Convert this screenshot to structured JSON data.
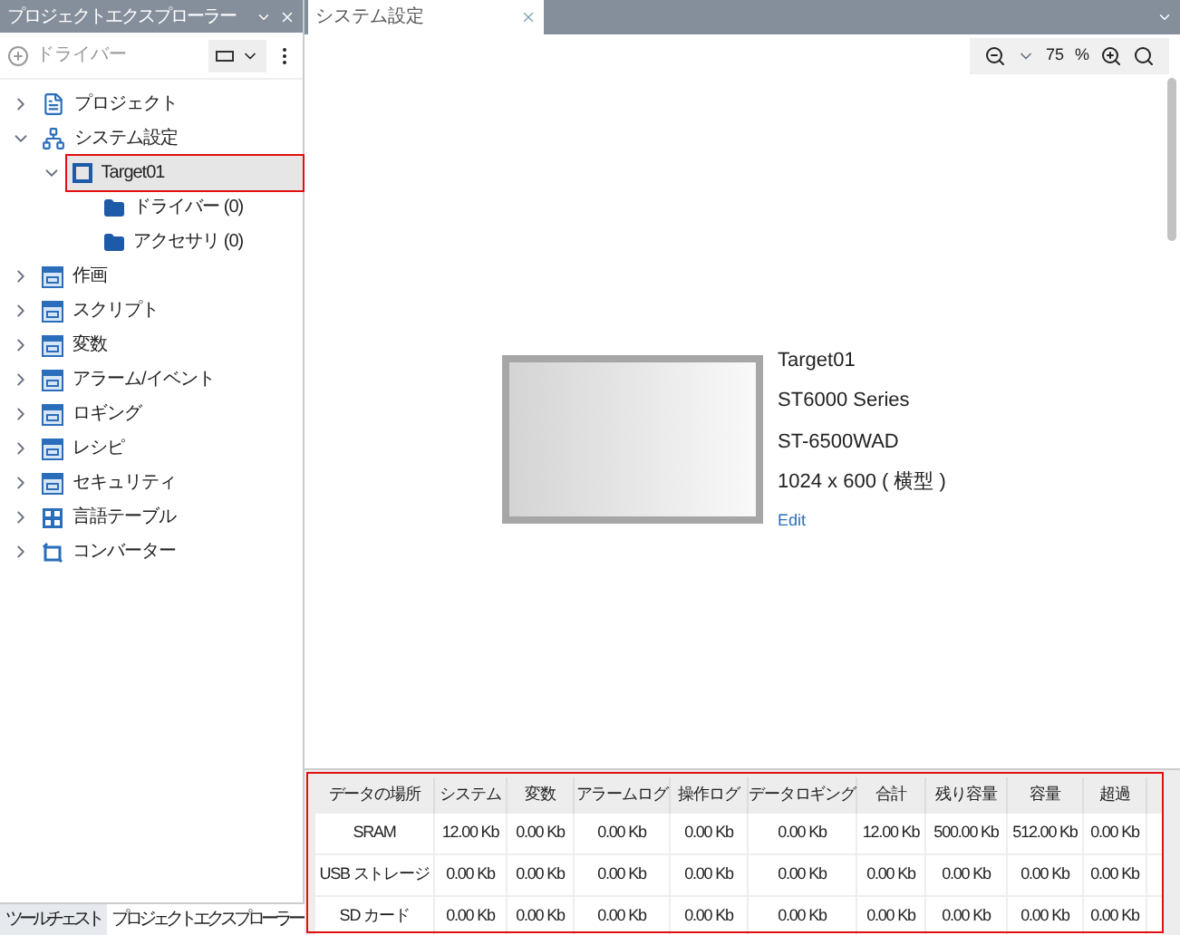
{
  "explorer": {
    "title": "プロジェクトエクスプローラー",
    "add_button": "ドライバー",
    "tree": [
      {
        "label": "プロジェクト",
        "kind": "page",
        "expanded": false,
        "selected": false
      },
      {
        "label": "システム設定",
        "kind": "network",
        "expanded": true,
        "selected": false,
        "children": [
          {
            "label": "Target01",
            "kind": "target",
            "expanded": true,
            "selected": true,
            "highlighted": true,
            "children": [
              {
                "label": "ドライバー (0)",
                "kind": "folder",
                "selected": false
              },
              {
                "label": "アクセサリ (0)",
                "kind": "folder",
                "selected": false
              }
            ]
          }
        ]
      },
      {
        "label": "作画",
        "kind": "screen",
        "expanded": false,
        "selected": false
      },
      {
        "label": "スクリプト",
        "kind": "screen",
        "expanded": false,
        "selected": false
      },
      {
        "label": "変数",
        "kind": "screen",
        "expanded": false,
        "selected": false
      },
      {
        "label": "アラーム/イベント",
        "kind": "screen",
        "expanded": false,
        "selected": false
      },
      {
        "label": "ロギング",
        "kind": "screen",
        "expanded": false,
        "selected": false
      },
      {
        "label": "レシピ",
        "kind": "screen",
        "expanded": false,
        "selected": false
      },
      {
        "label": "セキュリティ",
        "kind": "screen",
        "expanded": false,
        "selected": false
      },
      {
        "label": "言語テーブル",
        "kind": "grid",
        "expanded": false,
        "selected": false
      },
      {
        "label": "コンバーター",
        "kind": "convert",
        "expanded": false,
        "selected": false
      }
    ],
    "bottom_tabs": [
      {
        "label": "ツールチェスト",
        "selected": false
      },
      {
        "label": "プロジェクトエクスプローラー",
        "selected": true
      }
    ]
  },
  "document": {
    "tab": "システム設定",
    "zoom": "75",
    "zoom_unit": "%",
    "device": {
      "name": "Target01",
      "series": "ST6000 Series",
      "model": "ST-6500WAD",
      "resolution": "1024 x 600 ( 横型 )",
      "edit_link": "Edit"
    },
    "table": {
      "highlighted": true,
      "columns": [
        "データの場所",
        "システム",
        "変数",
        "アラームログ",
        "操作ログ",
        "データロギング",
        "合計",
        "残り容量",
        "容量",
        "超過"
      ],
      "rows": [
        [
          "SRAM",
          "12.00 Kb",
          "0.00 Kb",
          "0.00 Kb",
          "0.00 Kb",
          "0.00 Kb",
          "12.00 Kb",
          "500.00 Kb",
          "512.00 Kb",
          "0.00 Kb"
        ],
        [
          "USB ストレージ",
          "0.00 Kb",
          "0.00 Kb",
          "0.00 Kb",
          "0.00 Kb",
          "0.00 Kb",
          "0.00 Kb",
          "0.00 Kb",
          "0.00 Kb",
          "0.00 Kb"
        ],
        [
          "SD カード",
          "0.00 Kb",
          "0.00 Kb",
          "0.00 Kb",
          "0.00 Kb",
          "0.00 Kb",
          "0.00 Kb",
          "0.00 Kb",
          "0.00 Kb",
          "0.00 Kb"
        ]
      ]
    }
  }
}
